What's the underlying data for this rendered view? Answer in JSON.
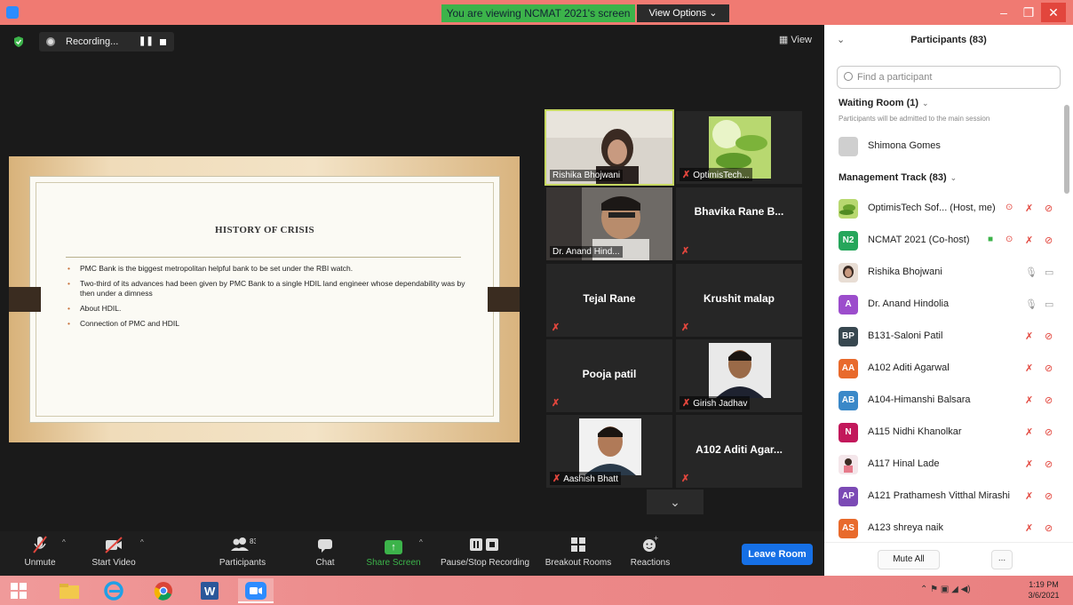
{
  "titlebar": {
    "viewing_banner": "You are viewing NCMAT 2021's screen",
    "view_options": "View Options ⌄",
    "minimize": "–",
    "restore": "❐",
    "close": "✕"
  },
  "meeting": {
    "recording_label": "Recording...",
    "pause_glyph": "❚❚",
    "view_label": "▦ View"
  },
  "slide": {
    "title": "HISTORY OF CRISIS",
    "bullets": [
      "PMC Bank is the biggest metropolitan helpful bank to be set under the RBI watch.",
      "Two-third of its advances had been given by PMC Bank to a single HDIL land engineer whose dependability was by then under a dimness",
      "About HDIL.",
      "Connection of PMC and HDIL"
    ]
  },
  "gallery": {
    "tiles": [
      {
        "caption": "Rishika Bhojwani"
      },
      {
        "caption": "OptimisTech..."
      },
      {
        "caption": "Dr. Anand Hind..."
      },
      {
        "name": "Bhavika Rane B..."
      },
      {
        "name": "Tejal Rane"
      },
      {
        "name": "Krushit malap"
      },
      {
        "name": "Pooja patil"
      },
      {
        "caption": "Girish Jadhav"
      },
      {
        "caption": "Aashish Bhatt"
      },
      {
        "name": "A102 Aditi Agar..."
      }
    ],
    "more_glyph": "⌄",
    "mute_glyph": "✗"
  },
  "toolbar": {
    "unmute": "Unmute",
    "start_video": "Start Video",
    "participants": "Participants",
    "participants_count": "83",
    "chat": "Chat",
    "share_screen": "Share Screen",
    "pause_stop_recording": "Pause/Stop Recording",
    "breakout_rooms": "Breakout Rooms",
    "reactions": "Reactions",
    "leave_room": "Leave Room",
    "caret": "^"
  },
  "panel": {
    "title": "Participants (83)",
    "collapse_glyph": "⌄",
    "search_placeholder": "Find a participant",
    "waiting_room": "Waiting Room (1)",
    "waiting_note": "Participants will be admitted to the main session",
    "waiting_person": "Shimona Gomes",
    "track": "Management Track (83)",
    "section_caret": "⌄",
    "participants": [
      {
        "name": "OptimisTech Sof...  (Host, me)",
        "initials": "",
        "color": "#8bc34a"
      },
      {
        "name": "NCMAT 2021 (Co-host)",
        "initials": "N2",
        "color": "#26a65b"
      },
      {
        "name": "Rishika Bhojwani",
        "initials": "",
        "color": "#8a6a5a"
      },
      {
        "name": "Dr. Anand Hindolia",
        "initials": "A",
        "color": "#9c4dcc"
      },
      {
        "name": "B131-Saloni Patil",
        "initials": "BP",
        "color": "#37474f"
      },
      {
        "name": "A102 Aditi Agarwal",
        "initials": "AA",
        "color": "#e86a2c"
      },
      {
        "name": "A104-Himanshi Balsara",
        "initials": "AB",
        "color": "#3a88c8"
      },
      {
        "name": "A115 Nidhi Khanolkar",
        "initials": "N",
        "color": "#c2185b"
      },
      {
        "name": "A117 Hinal Lade",
        "initials": "",
        "color": "#e67a8a"
      },
      {
        "name": "A121 Prathamesh Vitthal Mirashi",
        "initials": "AP",
        "color": "#7b4ab5"
      },
      {
        "name": "A123 shreya naik",
        "initials": "AS",
        "color": "#e86a2c"
      }
    ],
    "icons": {
      "mic_off": "✗",
      "video_off": "⊘",
      "mic_on": "🎙",
      "video_on": "▭",
      "rec": "⊙",
      "screen": "■"
    },
    "mute_all": "Mute All",
    "more": "..."
  },
  "taskbar": {
    "tray": "⌃  ⚑  ▣  ◢  ◀)",
    "time": "1:19 PM",
    "date": "3/6/2021",
    "apps": [
      "file-explorer",
      "internet-explorer",
      "chrome",
      "word",
      "zoom"
    ]
  }
}
